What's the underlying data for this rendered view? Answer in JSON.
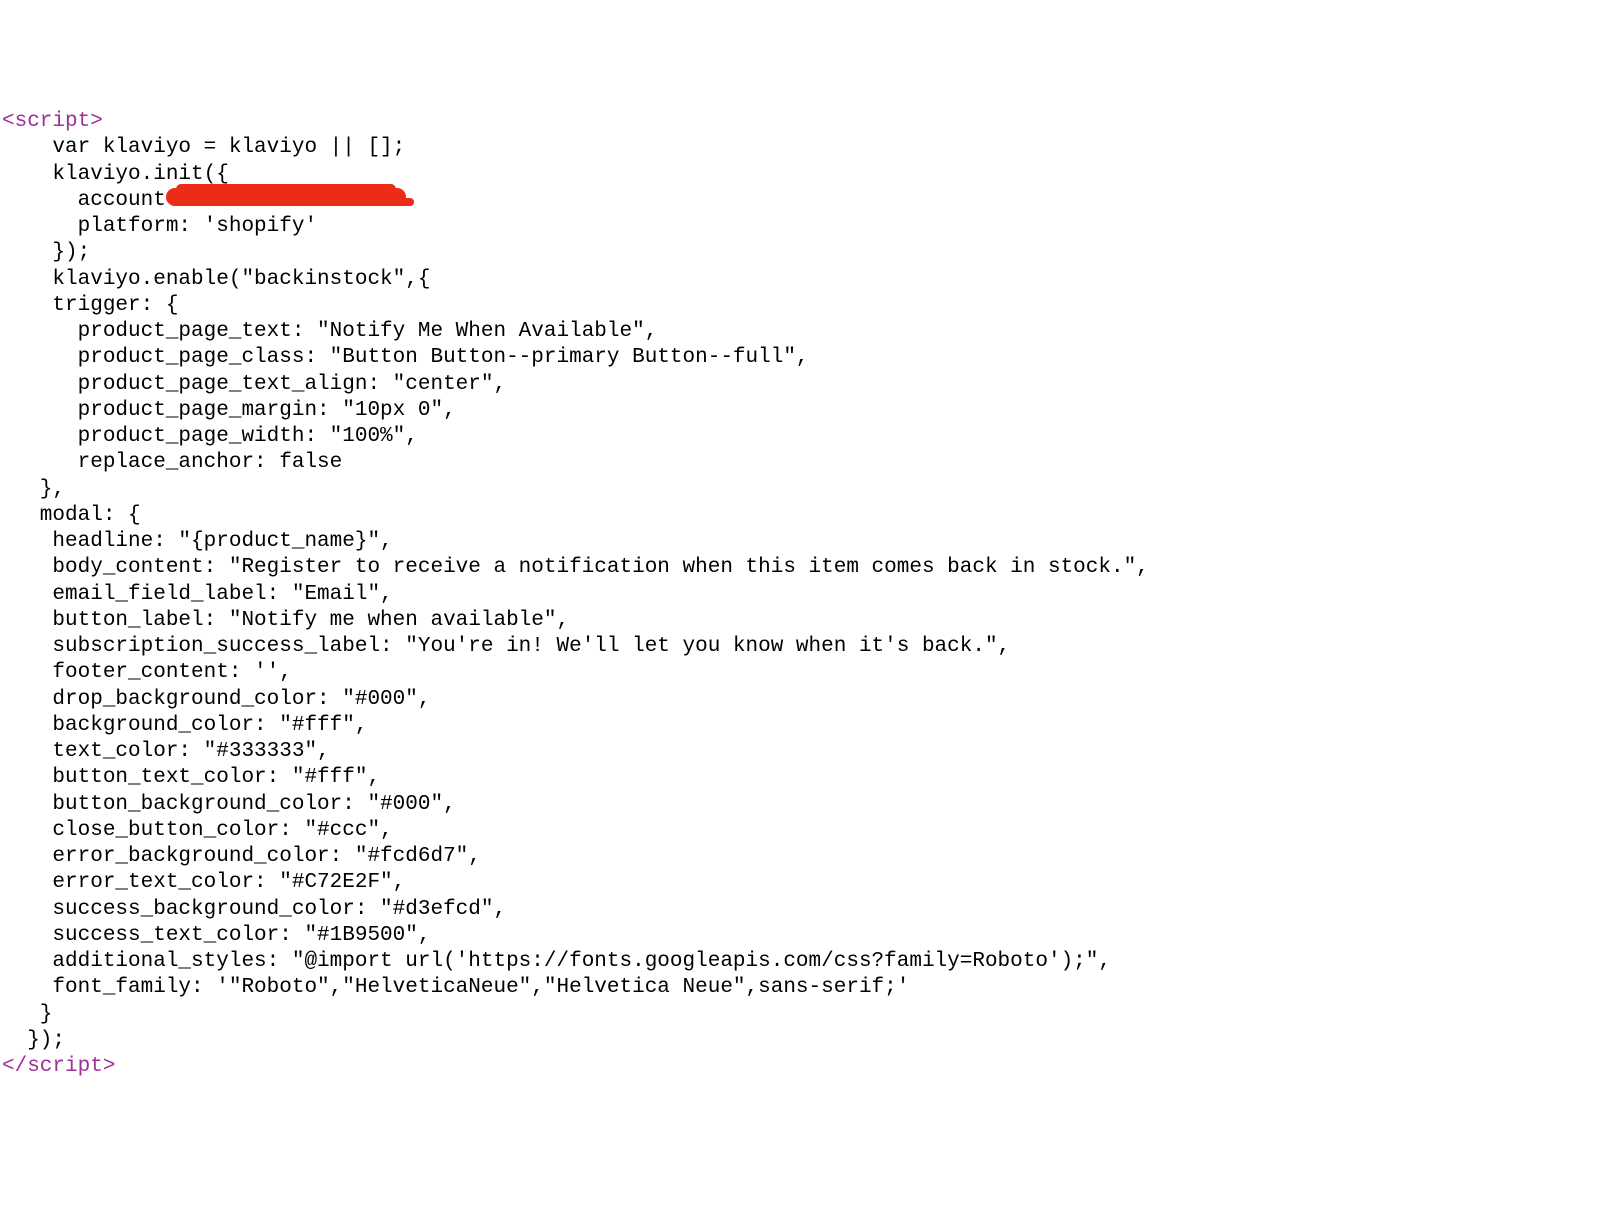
{
  "code": {
    "open_tag": "<script>",
    "close_tag": "</script>",
    "lines": [
      "    var klaviyo = klaviyo || [];",
      "    klaviyo.init({",
      "      account",
      "      platform: 'shopify'",
      "    });",
      "    klaviyo.enable(\"backinstock\",{",
      "    trigger: {",
      "      product_page_text: \"Notify Me When Available\",",
      "      product_page_class: \"Button Button--primary Button--full\",",
      "      product_page_text_align: \"center\",",
      "      product_page_margin: \"10px 0\",",
      "      product_page_width: \"100%\",",
      "      replace_anchor: false",
      "   },",
      "   modal: {",
      "    headline: \"{product_name}\",",
      "    body_content: \"Register to receive a notification when this item comes back in stock.\",",
      "    email_field_label: \"Email\",",
      "    button_label: \"Notify me when available\",",
      "    subscription_success_label: \"You're in! We'll let you know when it's back.\",",
      "    footer_content: '',",
      "    drop_background_color: \"#000\",",
      "    background_color: \"#fff\",",
      "    text_color: \"#333333\",",
      "    button_text_color: \"#fff\",",
      "    button_background_color: \"#000\",",
      "    close_button_color: \"#ccc\",",
      "    error_background_color: \"#fcd6d7\",",
      "    error_text_color: \"#C72E2F\",",
      "    success_background_color: \"#d3efcd\",",
      "    success_text_color: \"#1B9500\",",
      "    additional_styles: \"@import url('https://fonts.googleapis.com/css?family=Roboto');\",",
      "    font_family: '\"Roboto\",\"HelveticaNeue\",\"Helvetica Neue\",sans-serif;'",
      "   }",
      "  });"
    ]
  }
}
